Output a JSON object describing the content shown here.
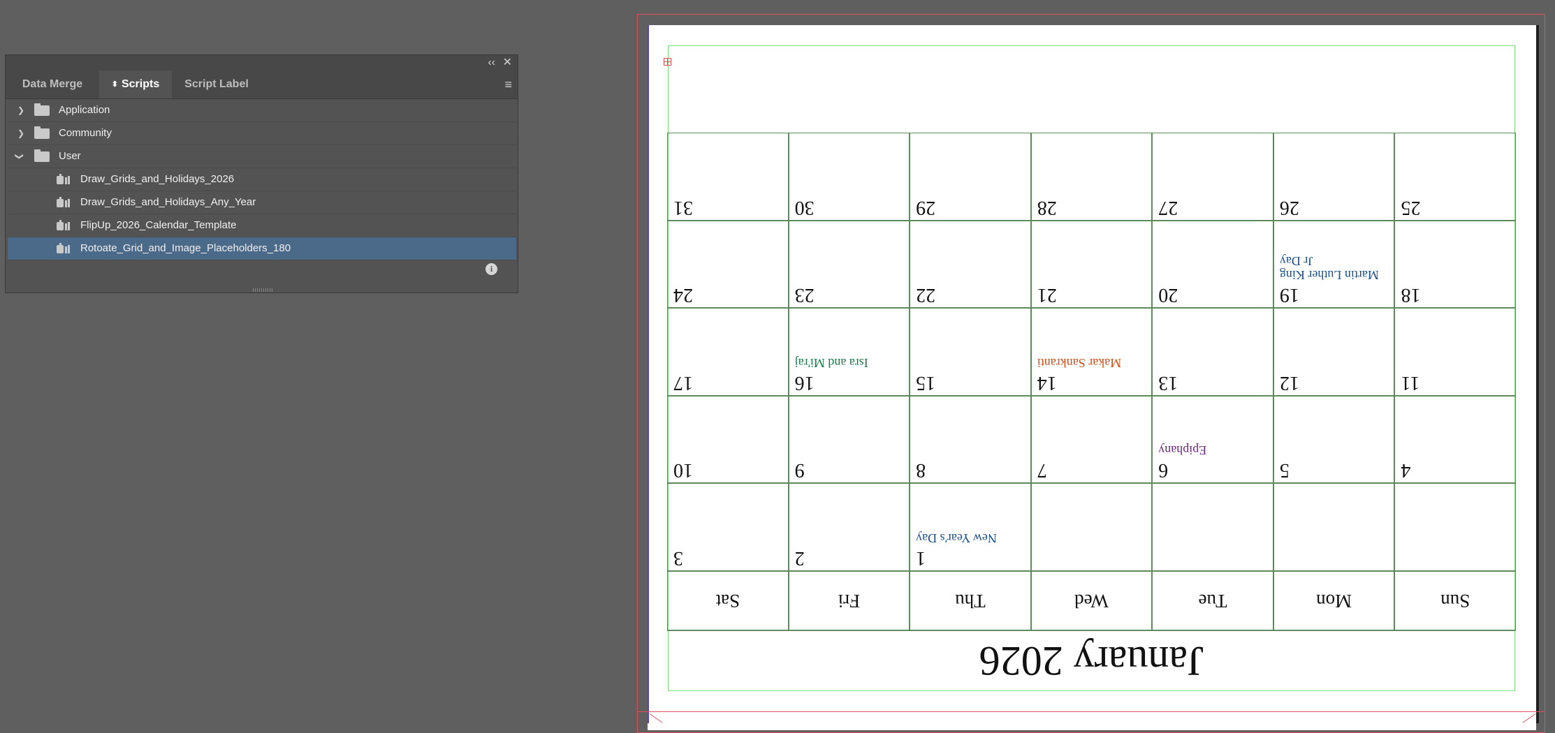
{
  "panel": {
    "tabs": [
      {
        "label": "Data Merge",
        "active": false
      },
      {
        "label": "Scripts",
        "active": true
      },
      {
        "label": "Script Label",
        "active": false
      }
    ],
    "folders": [
      {
        "label": "Application",
        "expanded": false
      },
      {
        "label": "Community",
        "expanded": false
      },
      {
        "label": "User",
        "expanded": true
      }
    ],
    "scripts": [
      {
        "label": "Draw_Grids_and_Holidays_2026",
        "selected": false
      },
      {
        "label": "Draw_Grids_and_Holidays_Any_Year",
        "selected": false
      },
      {
        "label": "FlipUp_2026_Calendar_Template",
        "selected": false
      },
      {
        "label": "Rotoate_Grid_and_Image_Placeholders_180",
        "selected": true
      }
    ],
    "icons": {
      "collapse": "double-chevron-left-icon",
      "close": "close-icon",
      "menu": "panel-menu-icon",
      "info": "info-icon",
      "script": "script-icon",
      "folder": "folder-icon"
    }
  },
  "calendar": {
    "title": "January 2026",
    "weekdays": [
      "Sun",
      "Mon",
      "Tue",
      "Wed",
      "Thu",
      "Fri",
      "Sat"
    ],
    "weeks": [
      [
        {
          "day": ""
        },
        {
          "day": ""
        },
        {
          "day": ""
        },
        {
          "day": ""
        },
        {
          "day": "1",
          "holiday": "New Year's Day",
          "color": "#1a4f8a"
        },
        {
          "day": "2"
        },
        {
          "day": "3"
        }
      ],
      [
        {
          "day": "4"
        },
        {
          "day": "5"
        },
        {
          "day": "6",
          "holiday": "Epiphany",
          "color": "#6b2a7a"
        },
        {
          "day": "7"
        },
        {
          "day": "8"
        },
        {
          "day": "9"
        },
        {
          "day": "10"
        }
      ],
      [
        {
          "day": "11"
        },
        {
          "day": "12"
        },
        {
          "day": "13"
        },
        {
          "day": "14",
          "holiday": "Makar Sankranti",
          "color": "#c8501a"
        },
        {
          "day": "15"
        },
        {
          "day": "16",
          "holiday": "Isra and Mi'raj",
          "color": "#1a7a4a"
        },
        {
          "day": "17"
        }
      ],
      [
        {
          "day": "18"
        },
        {
          "day": "19",
          "holiday": "Martin Luther King Jr Day",
          "color": "#1a4f8a"
        },
        {
          "day": "20"
        },
        {
          "day": "21"
        },
        {
          "day": "22"
        },
        {
          "day": "23"
        },
        {
          "day": "24"
        }
      ],
      [
        {
          "day": "25"
        },
        {
          "day": "26"
        },
        {
          "day": "27"
        },
        {
          "day": "28"
        },
        {
          "day": "29"
        },
        {
          "day": "30"
        },
        {
          "day": "31"
        }
      ]
    ]
  }
}
